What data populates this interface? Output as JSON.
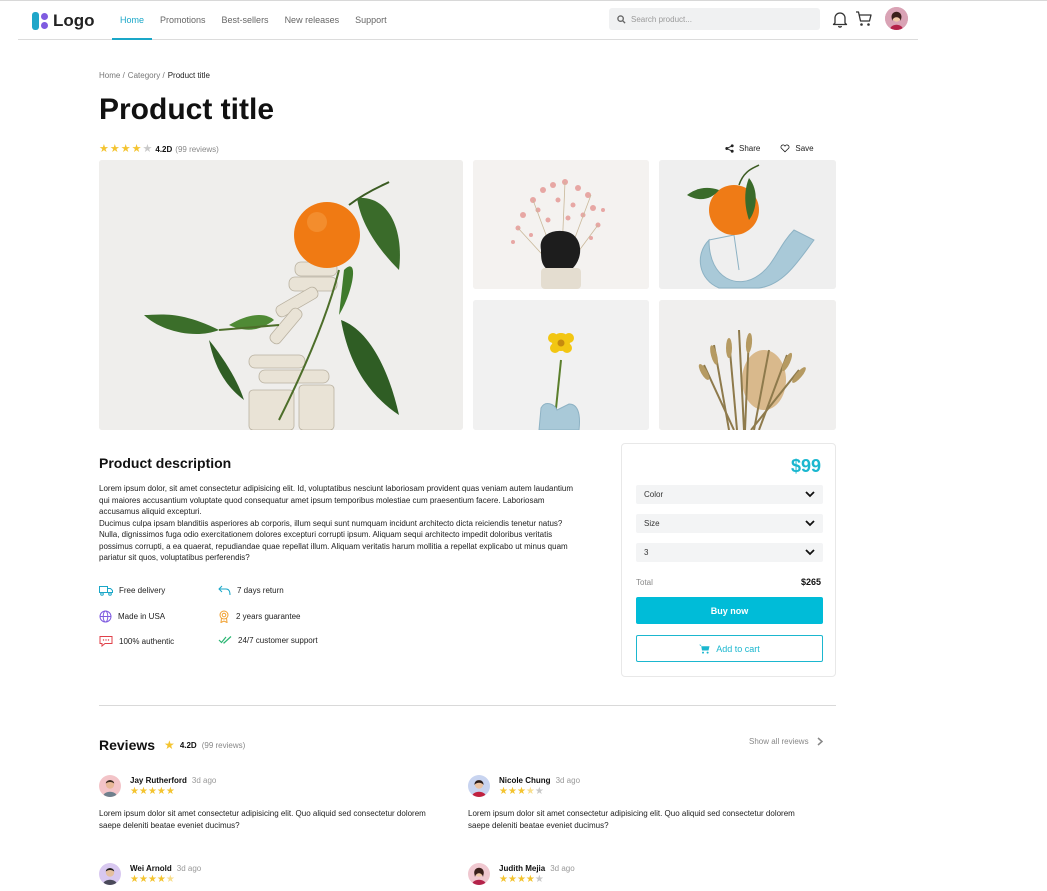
{
  "nav": {
    "logo": "Logo",
    "links": [
      "Home",
      "Promotions",
      "Best-sellers",
      "New releases",
      "Support"
    ],
    "search_placeholder": "Search product..."
  },
  "breadcrumb": [
    "Home /",
    "Category /",
    "Product title"
  ],
  "product": {
    "title": "Product title",
    "rating": "4.2D",
    "reviews_count": "(99 reviews)",
    "stars_filled": 4,
    "share": "Share",
    "save": "Save"
  },
  "description": {
    "heading": "Product description",
    "p1": "Lorem ipsum dolor, sit amet consectetur adipisicing elit. Id, voluptatibus nesciunt laboriosam provident quas veniam autem laudantium qui maiores accusantium voluptate quod consequatur amet ipsum temporibus molestiae cum praesentium facere. Laboriosam accusamus aliquid excepturi.",
    "p2": "Ducimus culpa ipsam blanditiis asperiores ab corporis, illum sequi sunt numquam incidunt architecto dicta reiciendis tenetur natus? Nulla, dignissimos fuga odio exercitationem dolores excepturi corrupti ipsum. Aliquam sequi architecto impedit doloribus veritatis possimus corrupti, a ea quaerat, repudiandae quae repellat illum. Aliquam veritatis harum mollitia a repellat explicabo ut minus quam pariatur sit quos, voluptatibus perferendis?"
  },
  "features": [
    {
      "icon": "truck-icon",
      "label": "Free delivery",
      "color": "#1aa7c8"
    },
    {
      "icon": "return-icon",
      "label": "7 days return",
      "color": "#1aa7c8"
    },
    {
      "icon": "globe-icon",
      "label": "Made in USA",
      "color": "#7f5be0"
    },
    {
      "icon": "medal-icon",
      "label": "2 years guarantee",
      "color": "#f0a030"
    },
    {
      "icon": "chat-icon",
      "label": "100% authentic",
      "color": "#e0404a"
    },
    {
      "icon": "double-check-icon",
      "label": "24/7 customer support",
      "color": "#2bb673"
    }
  ],
  "purchase": {
    "price": "$99",
    "color_label": "Color",
    "size_label": "Size",
    "quantity": "3",
    "total_label": "Total",
    "total_value": "$265",
    "buy_now": "Buy now",
    "add_to_cart": "Add to cart",
    "accent": "#00bcd8"
  },
  "reviews": {
    "heading": "Reviews",
    "rating": "4.2D",
    "count": "(99 reviews)",
    "show_all": "Show all reviews",
    "items": [
      {
        "name": "Jay Rutherford",
        "ago": "3d ago",
        "stars": 5,
        "text": "Lorem ipsum dolor sit amet consectetur adipisicing elit. Quo aliquid sed consectetur dolorem saepe deleniti beatae eveniet ducimus?"
      },
      {
        "name": "Nicole Chung",
        "ago": "3d ago",
        "stars": 3.5,
        "text": "Lorem ipsum dolor sit amet consectetur adipisicing elit. Quo aliquid sed consectetur dolorem saepe deleniti beatae eveniet ducimus?"
      },
      {
        "name": "Wei Arnold",
        "ago": "3d ago",
        "stars": 4.5,
        "text": ""
      },
      {
        "name": "Judith Mejia",
        "ago": "3d ago",
        "stars": 4,
        "text": ""
      }
    ]
  }
}
